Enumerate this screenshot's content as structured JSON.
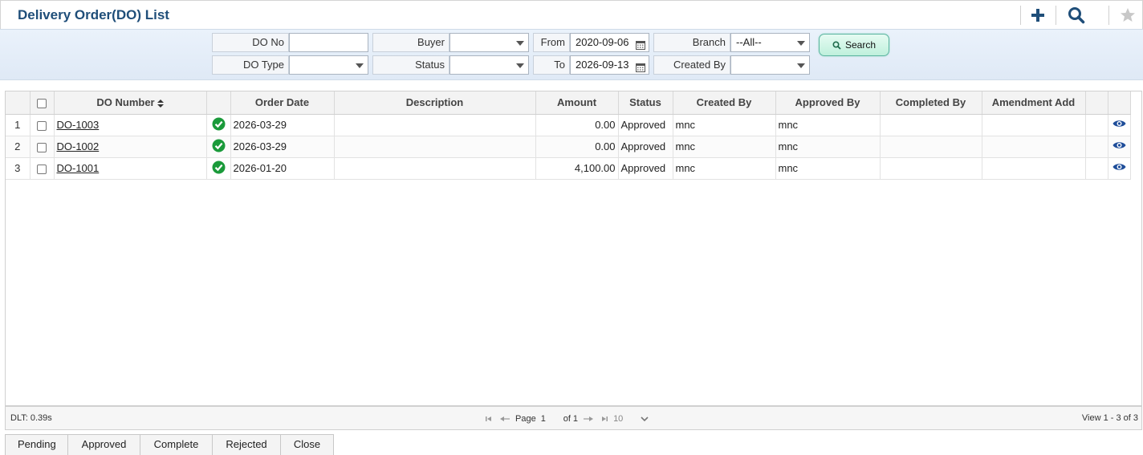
{
  "header": {
    "title": "Delivery Order(DO) List"
  },
  "toolbar": {
    "add_icon": "plus-icon",
    "search_icon": "search-icon",
    "favorite_icon": "star-icon"
  },
  "search": {
    "do_no_label": "DO No",
    "do_no_value": "",
    "buyer_label": "Buyer",
    "buyer_value": "",
    "from_label": "From",
    "from_value": "2020-09-06",
    "branch_label": "Branch",
    "branch_value": "--All--",
    "do_type_label": "DO Type",
    "do_type_value": "",
    "status_label": "Status",
    "status_value": "",
    "to_label": "To",
    "to_value": "2026-09-13",
    "created_by_label": "Created By",
    "created_by_value": "",
    "search_button": "Search"
  },
  "grid": {
    "columns": {
      "do_number": "DO Number",
      "order_date": "Order Date",
      "description": "Description",
      "amount": "Amount",
      "status": "Status",
      "created_by": "Created By",
      "approved_by": "Approved By",
      "completed_by": "Completed By",
      "amendment_add": "Amendment Add"
    },
    "rows": [
      {
        "num": "1",
        "do_number": "DO-1003",
        "order_date": "2026-03-29",
        "description": "",
        "amount": "0.00",
        "status": "Approved",
        "created_by": "mnc",
        "approved_by": "mnc",
        "completed_by": "",
        "amendment_add": ""
      },
      {
        "num": "2",
        "do_number": "DO-1002",
        "order_date": "2026-03-29",
        "description": "",
        "amount": "0.00",
        "status": "Approved",
        "created_by": "mnc",
        "approved_by": "mnc",
        "completed_by": "",
        "amendment_add": ""
      },
      {
        "num": "3",
        "do_number": "DO-1001",
        "order_date": "2026-01-20",
        "description": "",
        "amount": "4,100.00",
        "status": "Approved",
        "created_by": "mnc",
        "approved_by": "mnc",
        "completed_by": "",
        "amendment_add": ""
      }
    ]
  },
  "pager": {
    "dlt": "DLT: 0.39s",
    "page_label": "Page",
    "page_value": "1",
    "of_label": "of 1",
    "rows_per_page": "10",
    "view": "View 1 - 3 of 3"
  },
  "tabs": [
    "Pending",
    "Approved",
    "Complete",
    "Rejected",
    "Close"
  ],
  "colors": {
    "title": "#1f4e79",
    "approved_icon": "#1a9a3a",
    "view_icon": "#1f4e9a"
  }
}
